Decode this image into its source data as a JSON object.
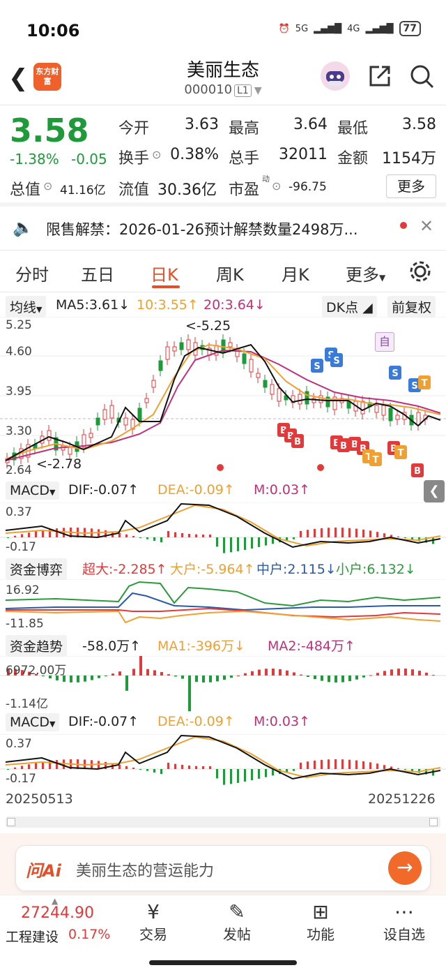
{
  "status_bar": {
    "time": "10:06",
    "net1": "5G",
    "net2": "4G",
    "battery": "77"
  },
  "header": {
    "logo_text": "东方财富",
    "title": "美丽生态",
    "code": "000010",
    "level": "L1"
  },
  "quote": {
    "price": "3.58",
    "change_pct": "-1.38%",
    "change": "-0.05",
    "open_label": "今开",
    "open": "3.63",
    "high_label": "最高",
    "high": "3.64",
    "low_label": "最低",
    "low": "3.58",
    "turnover_label": "换手",
    "turnover": "0.38%",
    "volume_label": "总手",
    "volume": "32011",
    "amount_label": "金额",
    "amount": "1154万",
    "mcap_label": "总值",
    "mcap": "41.16亿",
    "float_label": "流值",
    "float": "30.36亿",
    "pe_label": "市盈",
    "pe_sup": "动",
    "pe": "-96.75",
    "more": "更多"
  },
  "notice": {
    "text": "限售解禁：2026-01-26预计解禁数量2498万..."
  },
  "tabs": [
    "分时",
    "五日",
    "日K",
    "周K",
    "月K",
    "更多"
  ],
  "ma_bar": {
    "selector": "均线",
    "ma5": "MA5:3.61",
    "ma10": "10:3.55",
    "ma20": "20:3.64",
    "dk": "DK点",
    "adjust": "前复权"
  },
  "main_chart": {
    "y_labels": [
      "5.25",
      "4.60",
      "3.95",
      "3.30",
      "2.64"
    ],
    "high_note": "<-5.25",
    "low_note": "<-2.78",
    "self_tag": "自"
  },
  "macd1": {
    "selector": "MACD",
    "dif": "DIF:-0.07",
    "dea": "DEA:-0.09",
    "m": "M:0.03",
    "y_top": "0.37",
    "y_bottom": "-0.17"
  },
  "fund_game": {
    "title": "资金博弈",
    "super": "超大:-2.285",
    "big": "大户:-5.964",
    "mid": "中户:2.115",
    "small": "小户:6.132",
    "y_top": "16.92",
    "y_bottom": "-11.85"
  },
  "fund_trend": {
    "title": "资金趋势",
    "val": "-58.0万",
    "ma1": "MA1:-396万",
    "ma2": "MA2:-484万",
    "y_top": "6972.00万",
    "y_bottom": "-1.14亿"
  },
  "macd2": {
    "selector": "MACD",
    "dif": "DIF:-0.07",
    "dea": "DEA:-0.09",
    "m": "M:0.03",
    "y_top": "0.37",
    "y_bottom": "-0.17"
  },
  "dates": {
    "start": "20250513",
    "end": "20251226"
  },
  "ai_box": {
    "brand": "问Ai",
    "placeholder": "美丽生态的营运能力"
  },
  "bottom_nav": {
    "index_value": "27244.90",
    "index_name": "工程建设",
    "index_pct": "0.17%",
    "trade": "交易",
    "post": "发帖",
    "func": "功能",
    "watch": "设自选"
  },
  "colors": {
    "up": "#e23a3a",
    "down": "#1e9a3a",
    "accent": "#e2502a",
    "ma10": "#f0a030",
    "ma20": "#c0307a"
  }
}
